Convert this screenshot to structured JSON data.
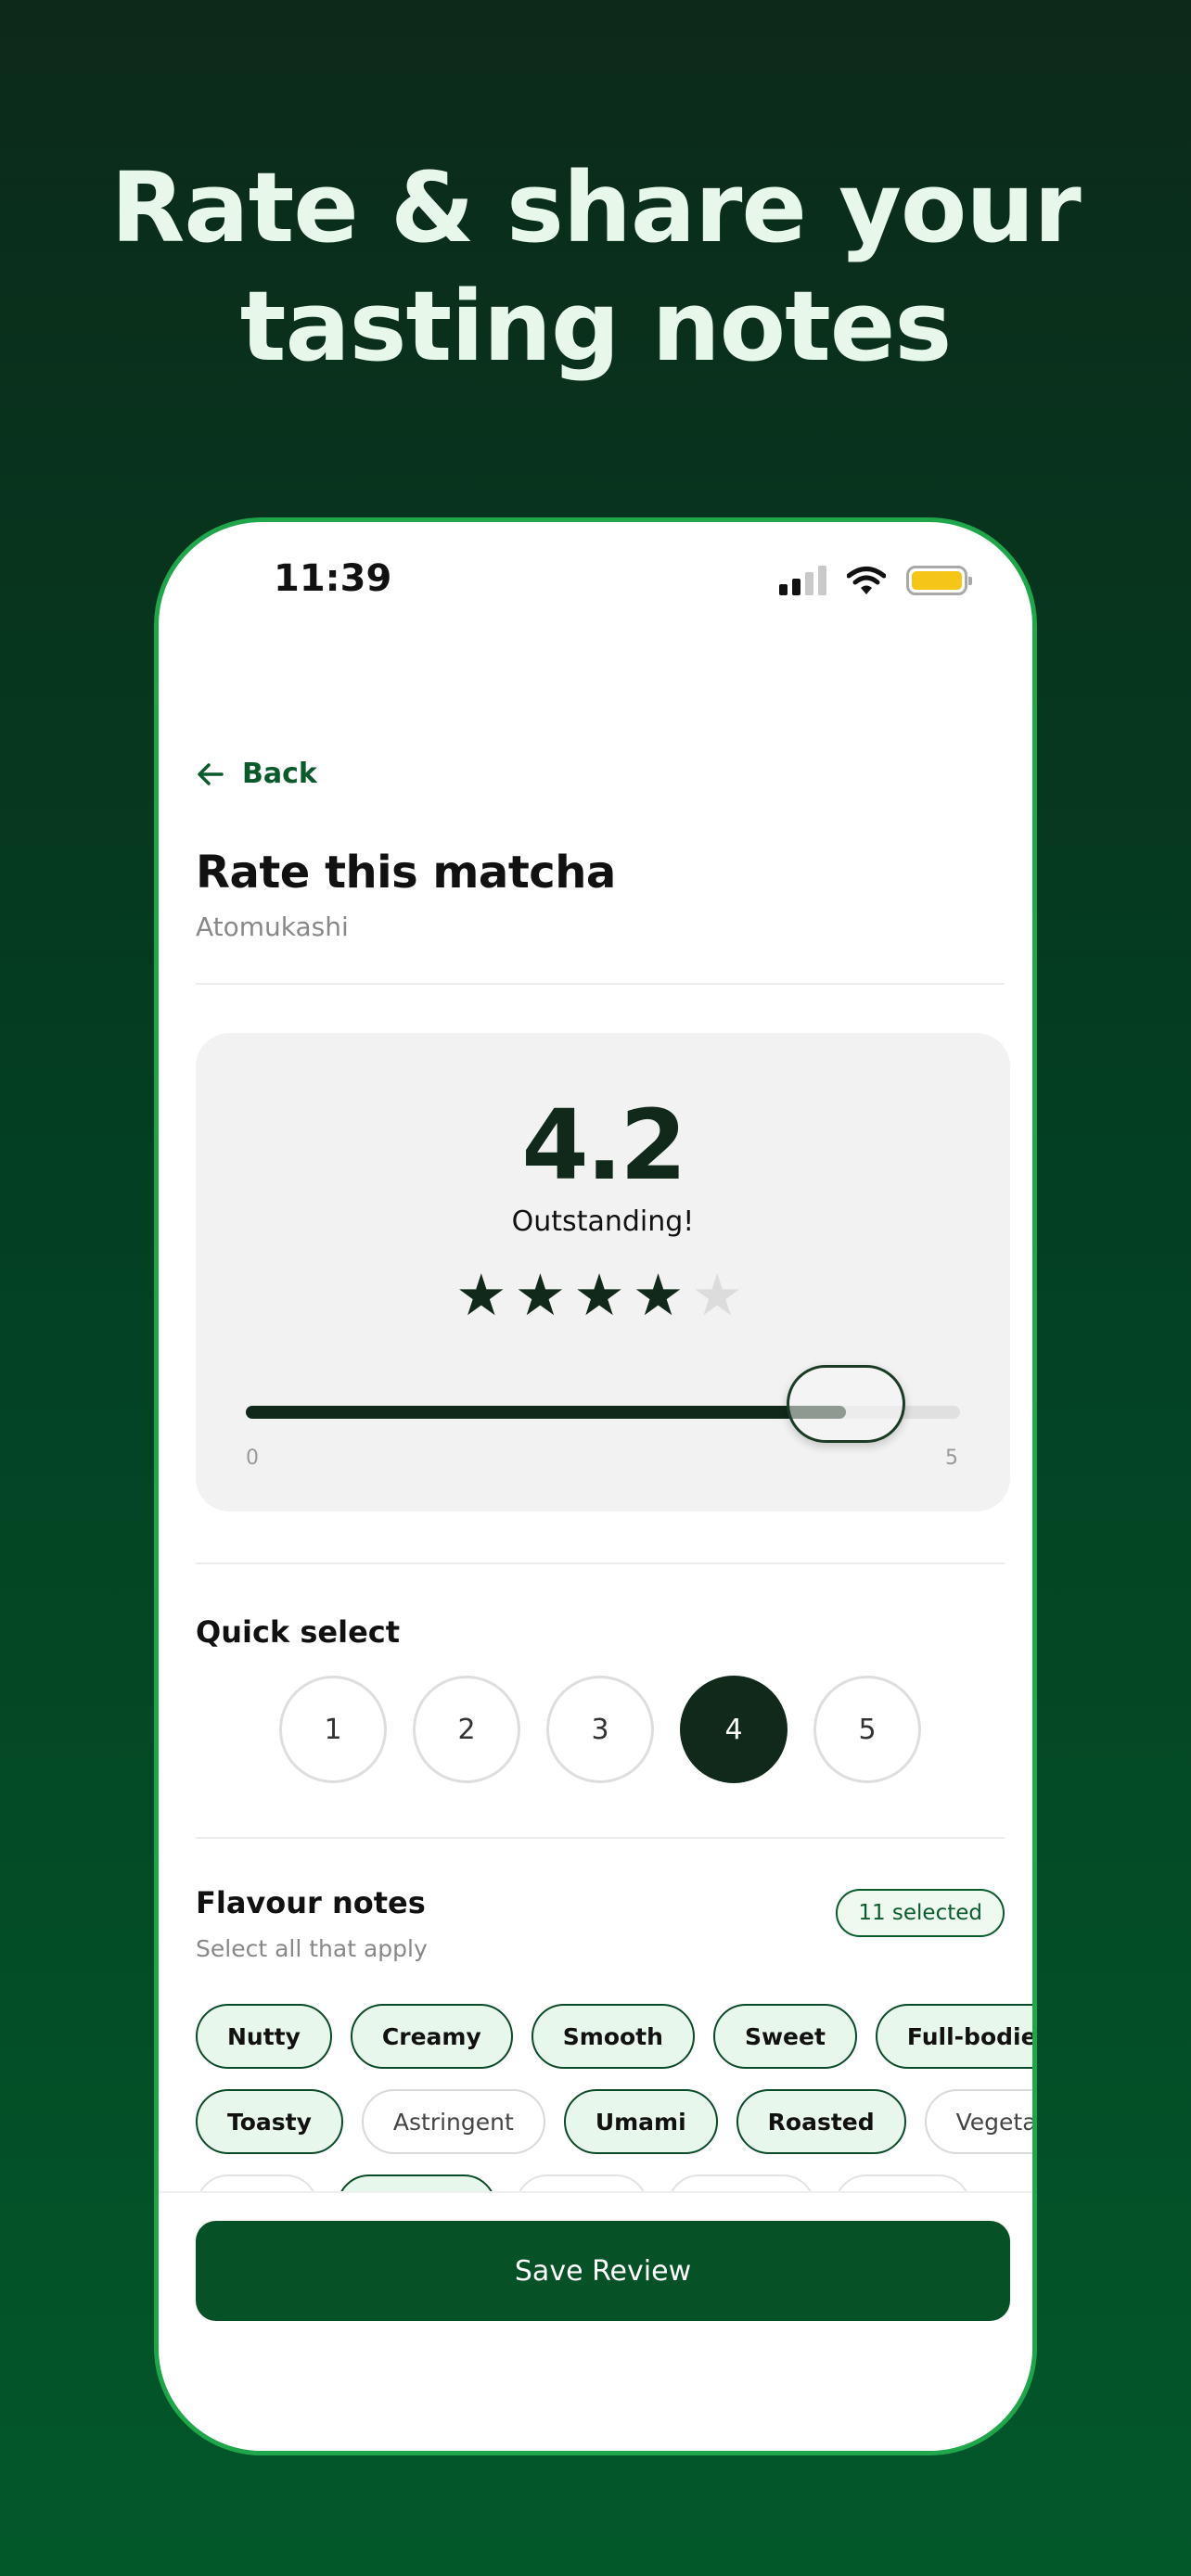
{
  "headline": {
    "line1": "Rate & share your",
    "line2": "tasting notes"
  },
  "status_bar": {
    "time": "11:39"
  },
  "nav": {
    "back_label": "Back"
  },
  "page": {
    "title": "Rate this matcha",
    "subtitle": "Atomukashi"
  },
  "rating": {
    "score": "4.2",
    "label": "Outstanding!",
    "stars_filled": 4,
    "stars_total": 5,
    "slider": {
      "value": 4.2,
      "min_label": "0",
      "max_label": "5",
      "min": 0,
      "max": 5
    }
  },
  "quick_select": {
    "title": "Quick select",
    "options": [
      "1",
      "2",
      "3",
      "4",
      "5"
    ],
    "selected": "4"
  },
  "flavour_notes": {
    "title": "Flavour notes",
    "subtitle": "Select all that apply",
    "badge": "11 selected",
    "row1": [
      {
        "label": "Nutty",
        "selected": true
      },
      {
        "label": "Creamy",
        "selected": true
      },
      {
        "label": "Smooth",
        "selected": true
      },
      {
        "label": "Sweet",
        "selected": true
      },
      {
        "label": "Full-bodied",
        "selected": true
      }
    ],
    "row2": [
      {
        "label": "Toasty",
        "selected": true
      },
      {
        "label": "Astringent",
        "selected": false
      },
      {
        "label": "Umami",
        "selected": true
      },
      {
        "label": "Roasted",
        "selected": true
      },
      {
        "label": "Vegetal",
        "selected": false
      }
    ]
  },
  "actions": {
    "save_label": "Save Review"
  },
  "colors": {
    "accent": "#075127",
    "dark": "#10291a",
    "chip_bg": "#e8f7eb"
  }
}
